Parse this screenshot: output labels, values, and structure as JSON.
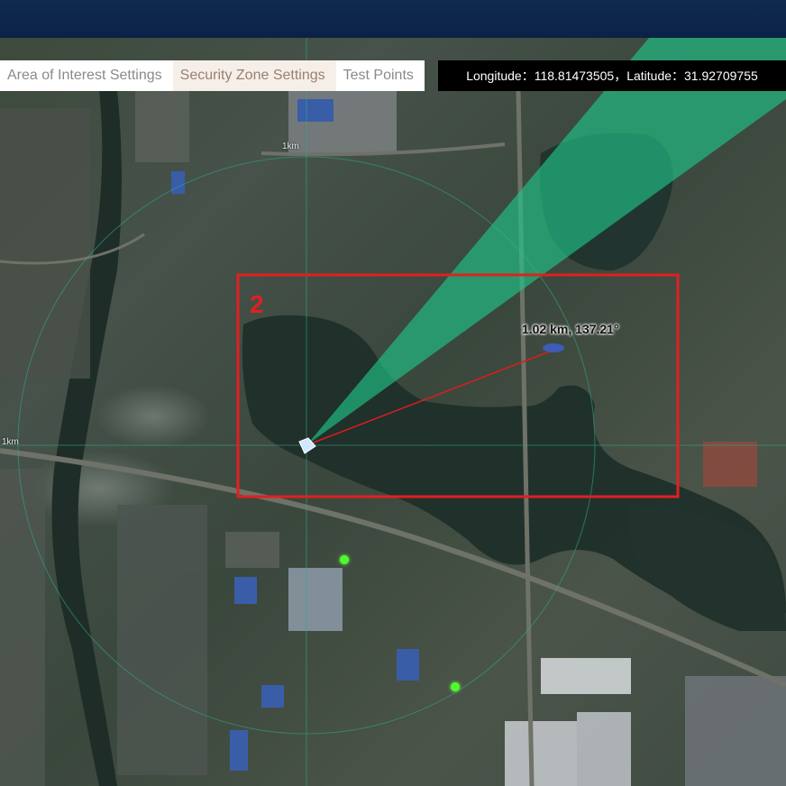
{
  "tabs": [
    {
      "label": "Area of Interest Settings",
      "active": false
    },
    {
      "label": "Security Zone Settings",
      "active": true
    },
    {
      "label": "Test Points",
      "active": false
    }
  ],
  "coordinates": {
    "longitude_label": "Longitude",
    "longitude": "118.81473505",
    "latitude_label": "Latitude",
    "latitude": "31.92709755",
    "display": "Longitude：118.81473505，Latitude：31.92709755"
  },
  "map": {
    "scale_label_top": "1km",
    "scale_label_left": "1km",
    "measurement": "1.02 km, 137.21°",
    "zone_number": "2",
    "colors": {
      "sector_fill": "#1ec98a",
      "zone_border": "#e02020",
      "measure_line": "#d81e1e",
      "marker": "#4cff2a",
      "grid_line": "#2fae8a"
    }
  }
}
